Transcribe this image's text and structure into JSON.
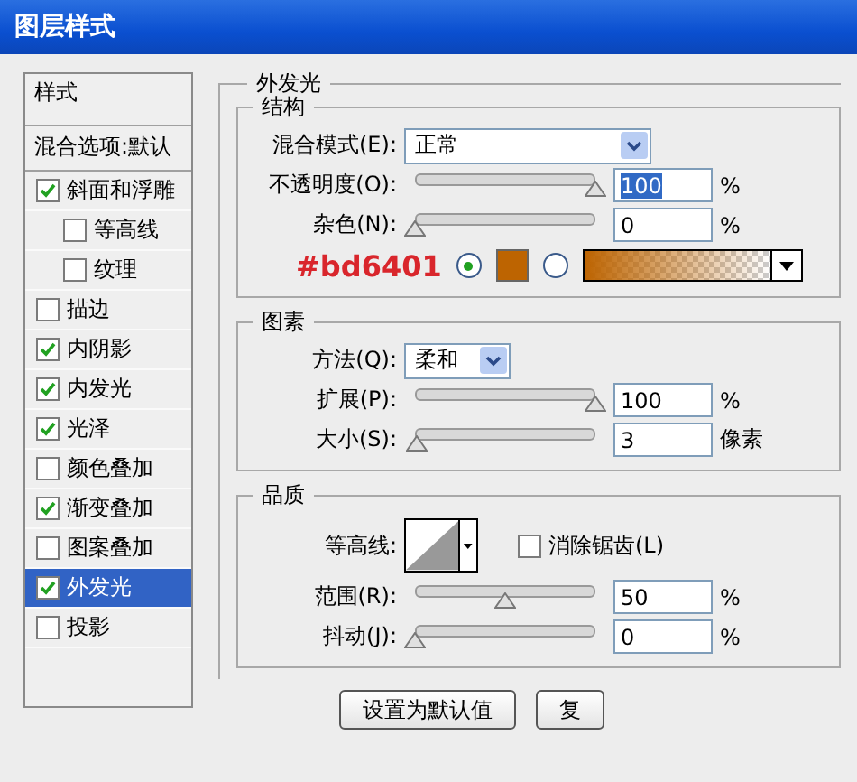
{
  "window": {
    "title": "图层样式"
  },
  "styles_panel": {
    "header": "样式",
    "blending_options": "混合选项:默认",
    "items": [
      {
        "label": "斜面和浮雕",
        "checked": true,
        "selected": false,
        "children": [
          {
            "label": "等高线",
            "checked": false,
            "selected": false
          },
          {
            "label": "纹理",
            "checked": false,
            "selected": false
          }
        ]
      },
      {
        "label": "描边",
        "checked": false,
        "selected": false
      },
      {
        "label": "内阴影",
        "checked": true,
        "selected": false
      },
      {
        "label": "内发光",
        "checked": true,
        "selected": false
      },
      {
        "label": "光泽",
        "checked": true,
        "selected": false
      },
      {
        "label": "颜色叠加",
        "checked": false,
        "selected": false
      },
      {
        "label": "渐变叠加",
        "checked": true,
        "selected": false
      },
      {
        "label": "图案叠加",
        "checked": false,
        "selected": false
      },
      {
        "label": "外发光",
        "checked": true,
        "selected": true
      },
      {
        "label": "投影",
        "checked": false,
        "selected": false
      }
    ]
  },
  "outer_glow": {
    "title": "外发光",
    "structure": {
      "title": "结构",
      "blend_mode": {
        "label": "混合模式(E):",
        "value": "正常"
      },
      "sliders": [
        {
          "label": "不透明度(O):",
          "level": 1,
          "value": "100",
          "unit": "%",
          "value_selected": true
        },
        {
          "label": "杂色(N):",
          "level": 0,
          "value": "0",
          "unit": "%",
          "value_selected": false
        }
      ],
      "annotation": "#bd6401",
      "color_options": [
        {
          "kind": "solid",
          "selected": true,
          "color": "#bd6401"
        },
        {
          "kind": "gradient",
          "selected": false,
          "color": "#bd6401"
        }
      ]
    },
    "elements": {
      "title": "图素",
      "technique": {
        "label": "方法(Q):",
        "value": "柔和"
      },
      "sliders": [
        {
          "label": "扩展(P):",
          "level": 1,
          "value": "100",
          "unit": "%",
          "value_selected": false
        },
        {
          "label": "大小(S):",
          "level": 0.01,
          "value": "3",
          "unit": "像素",
          "value_selected": false
        }
      ]
    },
    "quality": {
      "title": "品质",
      "contour": {
        "label": "等高线:"
      },
      "anti_alias": {
        "label": "消除锯齿(L)",
        "checked": false
      },
      "sliders": [
        {
          "label": "范围(R):",
          "level": 0.5,
          "value": "50",
          "unit": "%",
          "value_selected": false
        },
        {
          "label": "抖动(J):",
          "level": 0,
          "value": "0",
          "unit": "%",
          "value_selected": false
        }
      ]
    }
  },
  "buttons": [
    "设置为默认值",
    "复"
  ]
}
